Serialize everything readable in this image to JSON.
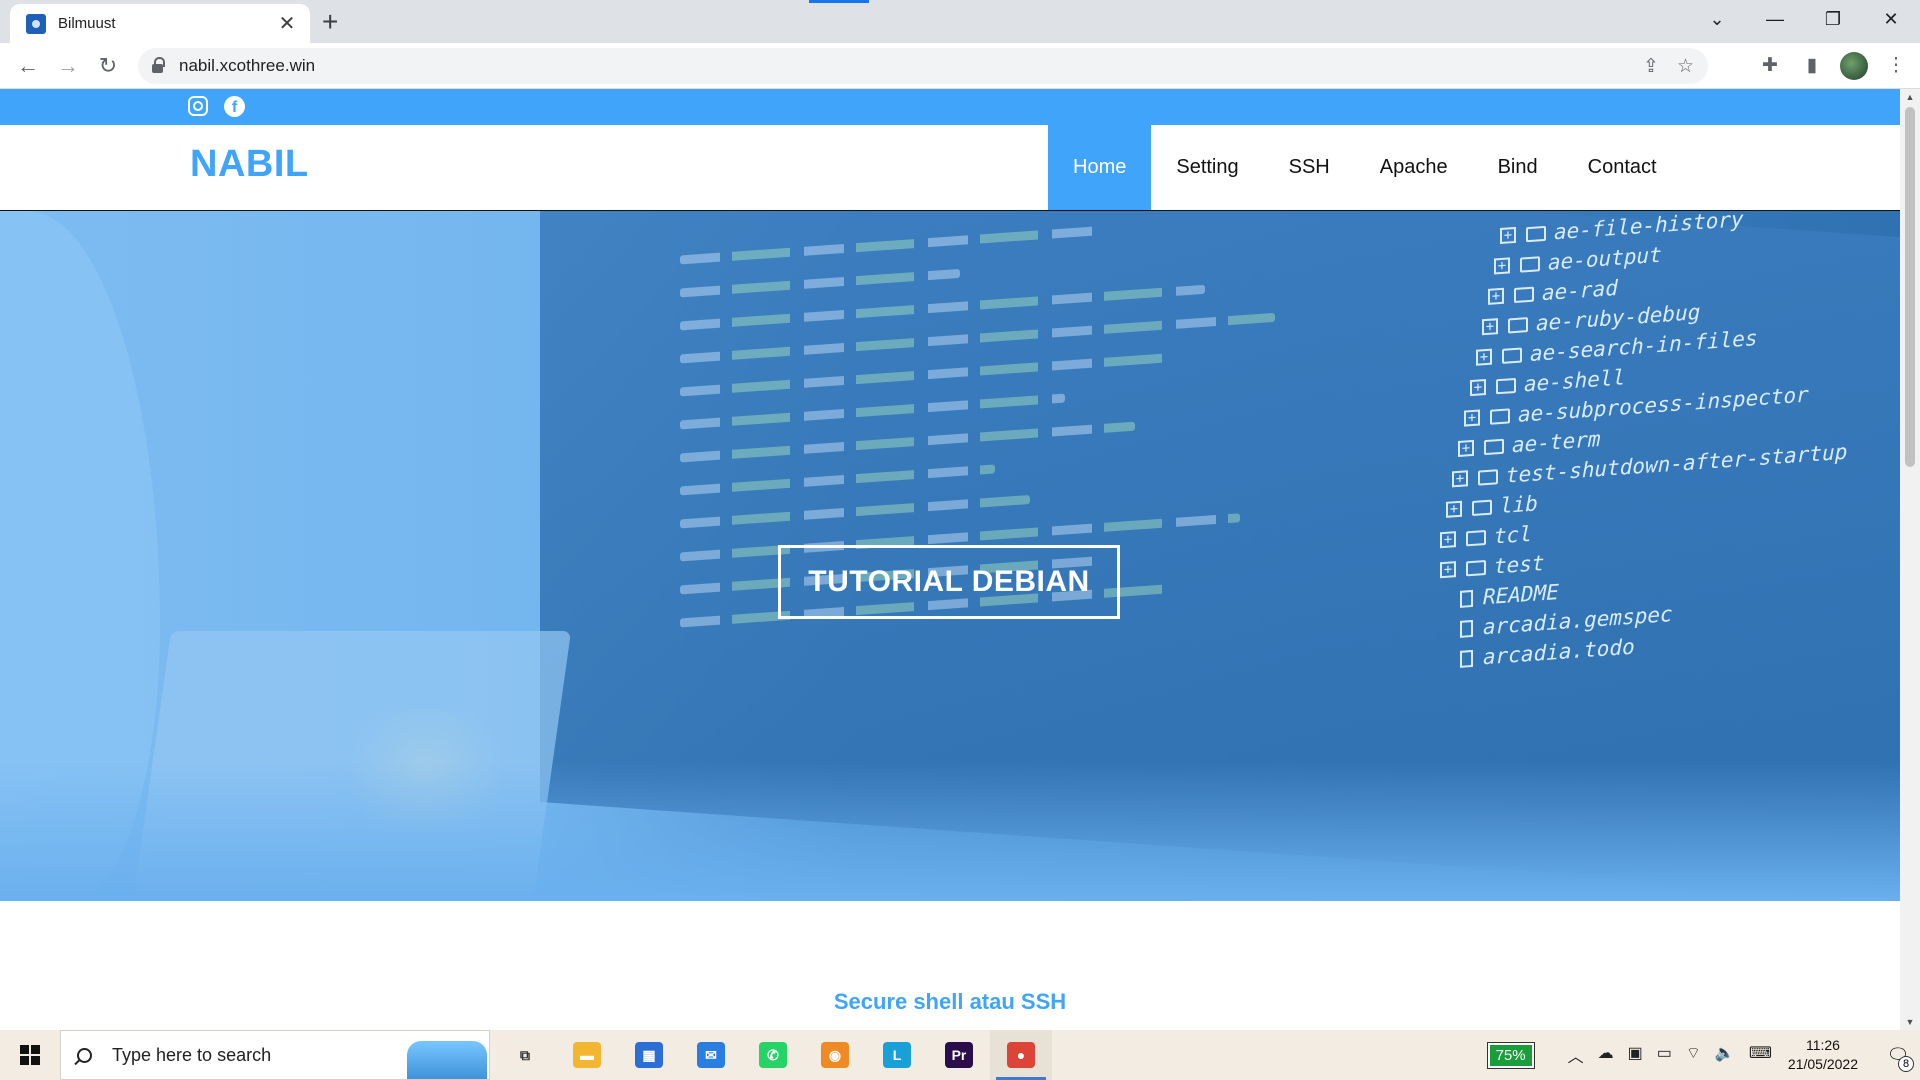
{
  "browser": {
    "tab_title": "Bilmuust",
    "close_glyph": "✕",
    "new_tab_glyph": "+",
    "url": "nabil.xcothree.win",
    "window_controls": [
      "⌄",
      "—",
      "❐",
      "✕"
    ]
  },
  "site": {
    "brand": "NABIL",
    "facebook_glyph": "f",
    "menu": [
      "Home",
      "Setting",
      "SSH",
      "Apache",
      "Bind",
      "Contact"
    ],
    "active_menu": "Home",
    "hero_title": "TUTORIAL DEBIAN",
    "section_title": "Secure shell atau SSH",
    "file_tree": [
      {
        "type": "folder",
        "name": "ae-file-history"
      },
      {
        "type": "folder",
        "name": "ae-output"
      },
      {
        "type": "folder",
        "name": "ae-rad"
      },
      {
        "type": "folder",
        "name": "ae-ruby-debug"
      },
      {
        "type": "folder",
        "name": "ae-search-in-files"
      },
      {
        "type": "folder",
        "name": "ae-shell"
      },
      {
        "type": "folder",
        "name": "ae-subprocess-inspector"
      },
      {
        "type": "folder",
        "name": "ae-term"
      },
      {
        "type": "folder",
        "name": "test-shutdown-after-startup"
      },
      {
        "type": "folder",
        "name": "lib"
      },
      {
        "type": "folder",
        "name": "tcl"
      },
      {
        "type": "folder",
        "name": "test"
      },
      {
        "type": "file",
        "name": "README"
      },
      {
        "type": "file",
        "name": "arcadia.gemspec"
      },
      {
        "type": "file",
        "name": "arcadia.todo"
      }
    ],
    "colors": {
      "accent": "#3fa4fa"
    }
  },
  "taskbar": {
    "search_placeholder": "Type here to search",
    "apps": [
      {
        "name": "task-view",
        "label": "⧉",
        "color": "#333333"
      },
      {
        "name": "file-explorer",
        "label": "▬",
        "color": "#f2b632"
      },
      {
        "name": "microsoft-store",
        "label": "▦",
        "color": "#2b6fd6"
      },
      {
        "name": "mail",
        "label": "✉",
        "color": "#2a7de1"
      },
      {
        "name": "whatsapp",
        "label": "✆",
        "color": "#25d366"
      },
      {
        "name": "browser-o",
        "label": "◉",
        "color": "#f08a24"
      },
      {
        "name": "app-l",
        "label": "L",
        "color": "#1aa0d8"
      },
      {
        "name": "premiere-pro",
        "label": "Pr",
        "color": "#2a0d4a"
      },
      {
        "name": "chrome",
        "label": "●",
        "color": "#db4437"
      }
    ],
    "active_app": "chrome",
    "battery": "75%",
    "time": "11:26",
    "date": "21/05/2022",
    "notification_count": "8"
  }
}
